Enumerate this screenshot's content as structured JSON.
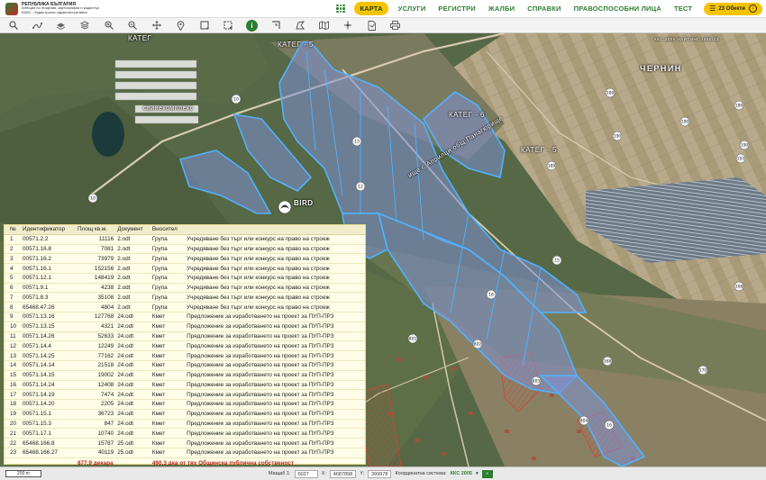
{
  "header": {
    "logo_line1": "РЕПУБЛИКА БЪЛГАРИЯ",
    "logo_line2": "Агенция по геодезия, картография и кадастър",
    "logo_line3": "КАИС - Кадастрално-административна",
    "nav": [
      "КАРТА",
      "УСЛУГИ",
      "РЕГИСТРИ",
      "ЖАЛБИ",
      "СПРАВКИ",
      "ПРАВОСПОСОБНИ ЛИЦА",
      "ТЕСТ"
    ],
    "active_nav": "КАРТА",
    "objects_label": "23 Обекти"
  },
  "toolbar": {
    "tools": [
      "search-icon",
      "route-icon",
      "layers-icon",
      "stack-icon",
      "zoom-in-icon",
      "zoom-out-icon",
      "pan-icon",
      "pin-icon",
      "select-rect-icon",
      "select-area-icon",
      "info-icon",
      "corner-icon",
      "polygon-icon",
      "map-icon",
      "split-icon",
      "document-icon",
      "print-icon"
    ],
    "active_tool": "info-icon",
    "info_glyph": "i"
  },
  "map": {
    "labels": {
      "kateg5_top": "КАТЕГ - 5",
      "kateg6": "КАТЕГ - 6",
      "kateg5_right": "КАТЕГ - 5",
      "chernin": "ЧЕРНИН",
      "kateg_left": "КАТЕГ",
      "road": "ище с Априлци общ Панагюрище",
      "kks_note": "ККС 2005 НАЙТИНГ 1986/03",
      "farm": "свинекомплекс",
      "bird_logo": "BIRD"
    },
    "colors": {
      "parcel_fill": "#7f8fd6",
      "parcel_stroke": "#4fb3ff",
      "hatch": "#e53935",
      "panel_bg": "#fffde8"
    }
  },
  "table": {
    "headers": [
      "№",
      "Идентификатор",
      "Площ кв.м.",
      "Документ",
      "Вносител",
      ""
    ],
    "rows": [
      [
        "1",
        "00571.2.2",
        "11116",
        "2.odt",
        "Група",
        "Учредяване без търг или конкурс на право на строеж"
      ],
      [
        "2",
        "00571.16.8",
        "7081",
        "2.odt",
        "Група",
        "Учредяване без търг или конкурс на право на строеж"
      ],
      [
        "3",
        "00571.16.2",
        "73979",
        "2.odt",
        "Група",
        "Учредяване без търг или конкурс на право на строеж"
      ],
      [
        "4",
        "00571.16.1",
        "152156",
        "2.odt",
        "Група",
        "Учредяване без търг или конкурс на право на строеж"
      ],
      [
        "5",
        "00571.12.1",
        "148419",
        "2.odt",
        "Група",
        "Учредяване без търг или конкурс на право на строеж"
      ],
      [
        "6",
        "00571.9.1",
        "4238",
        "2.odt",
        "Група",
        "Учредяване без търг или конкурс на право на строеж"
      ],
      [
        "7",
        "00571.8.3",
        "35108",
        "2.odt",
        "Група",
        "Учредяване без търг или конкурс на право на строеж"
      ],
      [
        "8",
        "65468.47.26",
        "4804",
        "2.odt",
        "Група",
        "Учредяване без търг или конкурс на право на строеж"
      ],
      [
        "9",
        "00571.13.16",
        "127768",
        "24.odt",
        "Кмет",
        "Предложение за изработването на проект за ПУП-ПРЗ"
      ],
      [
        "10",
        "00571.13.15",
        "4321",
        "24.odt",
        "Кмет",
        "Предложение за изработването на проект за ПУП-ПРЗ"
      ],
      [
        "11",
        "00571.14.26",
        "52633",
        "24.odt",
        "Кмет",
        "Предложение за изработването на проект за ПУП-ПРЗ"
      ],
      [
        "12",
        "00571.14.4",
        "12249",
        "24.odt",
        "Кмет",
        "Предложение за изработването на проект за ПУП-ПРЗ"
      ],
      [
        "13",
        "00571.14.25",
        "77162",
        "24.odt",
        "Кмет",
        "Предложение за изработването на проект за ПУП-ПРЗ"
      ],
      [
        "14",
        "00571.14.14",
        "21518",
        "24.odt",
        "Кмет",
        "Предложение за изработването на проект за ПУП-ПРЗ"
      ],
      [
        "15",
        "00571.14.15",
        "19002",
        "24.odt",
        "Кмет",
        "Предложение за изработването на проект за ПУП-ПРЗ"
      ],
      [
        "16",
        "00571.14.24",
        "12408",
        "24.odt",
        "Кмет",
        "Предложение за изработването на проект за ПУП-ПРЗ"
      ],
      [
        "17",
        "00571.14.19",
        "7474",
        "24.odt",
        "Кмет",
        "Предложение за изработването на проект за ПУП-ПРЗ"
      ],
      [
        "18",
        "00571.14.20",
        "2205",
        "24.odt",
        "Кмет",
        "Предложение за изработването на проект за ПУП-ПРЗ"
      ],
      [
        "19",
        "00571.15.1",
        "36723",
        "24.odt",
        "Кмет",
        "Предложение за изработването на проект за ПУП-ПРЗ"
      ],
      [
        "20",
        "00571.15.3",
        "847",
        "24.odt",
        "Кмет",
        "Предложение за изработването на проект за ПУП-ПРЗ"
      ],
      [
        "21",
        "00571.17.1",
        "10740",
        "24.odt",
        "Кмет",
        "Предложение за изработването на проект за ПУП-ПРЗ"
      ],
      [
        "22",
        "65468.166.8",
        "15787",
        "25.odt",
        "Кмет",
        "Предложение за изработването на проект за ПУП-ПРЗ"
      ],
      [
        "23",
        "65468.166.27",
        "40119",
        "25.odt",
        "Кмет",
        "Предложение за изработването на проект за ПУП-ПРЗ"
      ]
    ],
    "total_area": "877.9 декара",
    "total_public": "490.3 дка от тях Общинска публична собственост"
  },
  "statusbar": {
    "scale_label": "200 m",
    "scale_prefix": "Мащаб 1:",
    "scale_value": "6027",
    "x_label": "X:",
    "x_value": "4687898",
    "y_label": "Y:",
    "y_value": "399978",
    "crs_label": "Координатна система:",
    "crs_value": "ККС 2005"
  }
}
